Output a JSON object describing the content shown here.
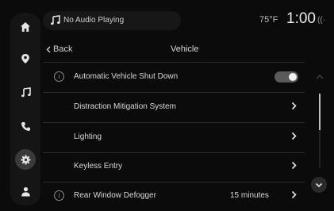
{
  "nav": {
    "items": [
      {
        "name": "home",
        "icon": "home-icon",
        "active": false
      },
      {
        "name": "navigation",
        "icon": "location-pin-icon",
        "active": false
      },
      {
        "name": "media",
        "icon": "music-note-icon",
        "active": false
      },
      {
        "name": "phone",
        "icon": "phone-icon",
        "active": false
      },
      {
        "name": "settings",
        "icon": "gear-icon",
        "active": true
      },
      {
        "name": "profile",
        "icon": "person-icon",
        "active": false
      }
    ]
  },
  "status": {
    "audio": "No Audio Playing",
    "temperature": "75°F",
    "time": "1:00",
    "signal": "((·"
  },
  "header": {
    "back_label": "Back",
    "title": "Vehicle"
  },
  "rows": [
    {
      "label": "Automatic Vehicle Shut Down",
      "info": true,
      "toggle": true,
      "toggle_on": true
    },
    {
      "label": "Distraction Mitigation System",
      "info": false,
      "chevron": true
    },
    {
      "label": "Lighting",
      "info": false,
      "chevron": true
    },
    {
      "label": "Keyless Entry",
      "info": false,
      "chevron": true
    },
    {
      "label": "Rear Window Defogger",
      "info": true,
      "value": "15 minutes",
      "chevron": true
    }
  ],
  "scroll": {
    "position_fraction": 0.0
  }
}
